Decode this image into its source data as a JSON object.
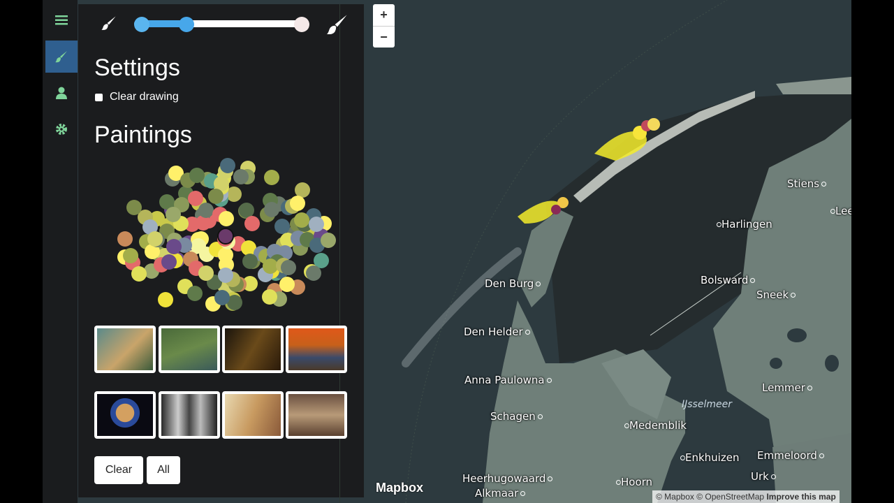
{
  "sidebar": {
    "tabs": [
      {
        "name": "menu",
        "icon": "hamburger-icon"
      },
      {
        "name": "paint",
        "icon": "brush-icon"
      },
      {
        "name": "user",
        "icon": "user-icon"
      },
      {
        "name": "settings",
        "icon": "gear-icon"
      }
    ]
  },
  "panel": {
    "settings_title": "Settings",
    "clear_drawing_label": "Clear drawing",
    "paintings_title": "Paintings",
    "clear_button": "Clear",
    "all_button": "All"
  },
  "map": {
    "zoom_in": "+",
    "zoom_out": "−",
    "logo": "Mapbox",
    "attribution_mapbox": "© Mapbox",
    "attribution_osm": "© OpenStreetMap",
    "attribution_improve": "Improve this map",
    "water_label": "IJsselmeer",
    "cities": [
      "Stiens",
      "Leeuwarden",
      "Harlingen",
      "Den Burg",
      "Bolsward",
      "Sneek",
      "Den Helder",
      "Anna Paulowna",
      "Lemmer",
      "Schagen",
      "Medemblik",
      "Enkhuizen",
      "Emmeloord",
      "Heerhugowaard",
      "Urk",
      "Hoorn",
      "Alkmaar"
    ]
  },
  "colors": {
    "panel_bg": "#1b1c1e",
    "accent_blue": "#47a7ea",
    "tab_icon_green": "#7fd49a",
    "land": "#6f7f79",
    "sea": "#2d3a3f"
  }
}
